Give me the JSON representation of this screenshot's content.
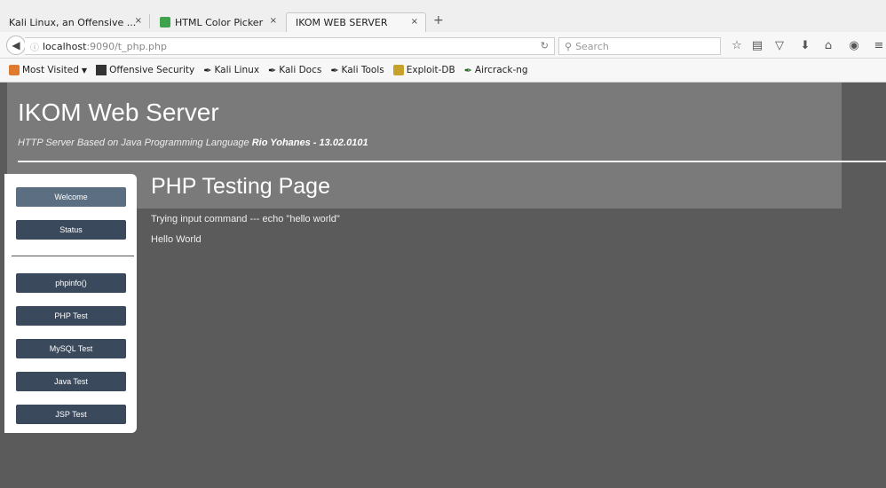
{
  "browser": {
    "tabs": [
      {
        "title": "Kali Linux, an Offensive ..."
      },
      {
        "title": "HTML Color Picker"
      },
      {
        "title": "IKOM WEB SERVER"
      }
    ],
    "tab_close": "×",
    "new_tab": "+",
    "url_host": "localhost",
    "url_path": ":9090/t_php.php",
    "search_placeholder": "Search",
    "bookmarks": [
      {
        "label": "Most Visited",
        "icon": "folder-icon"
      },
      {
        "label": "Offensive Security",
        "icon": "offensive-security-icon"
      },
      {
        "label": "Kali Linux",
        "icon": "kali-dragon-icon"
      },
      {
        "label": "Kali Docs",
        "icon": "kali-dragon-icon"
      },
      {
        "label": "Kali Tools",
        "icon": "kali-dragon-icon"
      },
      {
        "label": "Exploit-DB",
        "icon": "exploit-db-icon"
      },
      {
        "label": "Aircrack-ng",
        "icon": "aircrack-icon"
      }
    ]
  },
  "site": {
    "title": "IKOM Web Server",
    "subtitle_prefix": "HTTP Server Based on Java Programming Language",
    "subtitle_author": "Rio Yohanes - 13.02.0101"
  },
  "sidebar": {
    "top_items": [
      {
        "label": "Welcome"
      },
      {
        "label": "Status"
      }
    ],
    "items": [
      {
        "label": "phpinfo()"
      },
      {
        "label": "PHP Test"
      },
      {
        "label": "MySQL Test"
      },
      {
        "label": "Java Test"
      },
      {
        "label": "JSP Test"
      }
    ]
  },
  "content": {
    "title": "PHP Testing Page",
    "lines": [
      "Trying input command --- echo \"hello world\"",
      "Hello World"
    ]
  },
  "colors": {
    "button": "#3a4a5c",
    "button_active": "#5c6e81",
    "page_bg": "#5b5b5b",
    "header_bg": "#7a7a7a"
  }
}
